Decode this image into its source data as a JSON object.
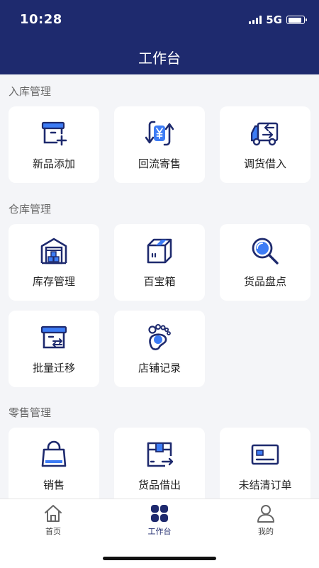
{
  "status": {
    "time": "10:28",
    "network": "5G",
    "battery": 0.9
  },
  "header": {
    "title": "工作台"
  },
  "sections": [
    {
      "title": "入库管理",
      "items": [
        {
          "label": "新品添加",
          "icon": "box-add-icon"
        },
        {
          "label": "回流寄售",
          "icon": "yuan-return-icon"
        },
        {
          "label": "调货借入",
          "icon": "truck-icon"
        }
      ]
    },
    {
      "title": "仓库管理",
      "items": [
        {
          "label": "库存管理",
          "icon": "warehouse-icon"
        },
        {
          "label": "百宝箱",
          "icon": "treasure-box-icon"
        },
        {
          "label": "货品盘点",
          "icon": "magnifier-icon"
        },
        {
          "label": "批量迁移",
          "icon": "box-transfer-icon"
        },
        {
          "label": "店铺记录",
          "icon": "footprint-icon"
        }
      ]
    },
    {
      "title": "零售管理",
      "items": [
        {
          "label": "销售",
          "icon": "shopping-bag-icon"
        },
        {
          "label": "货品借出",
          "icon": "box-lend-icon"
        },
        {
          "label": "未结清订单",
          "icon": "card-icon"
        }
      ]
    }
  ],
  "tabbar": [
    {
      "label": "首页",
      "icon": "home-icon",
      "active": false
    },
    {
      "label": "工作台",
      "icon": "grid-icon",
      "active": true
    },
    {
      "label": "我的",
      "icon": "user-icon",
      "active": false
    }
  ],
  "colors": {
    "primary": "#1e2a6e",
    "accent": "#3d7cf5",
    "background": "#f4f5f8"
  }
}
